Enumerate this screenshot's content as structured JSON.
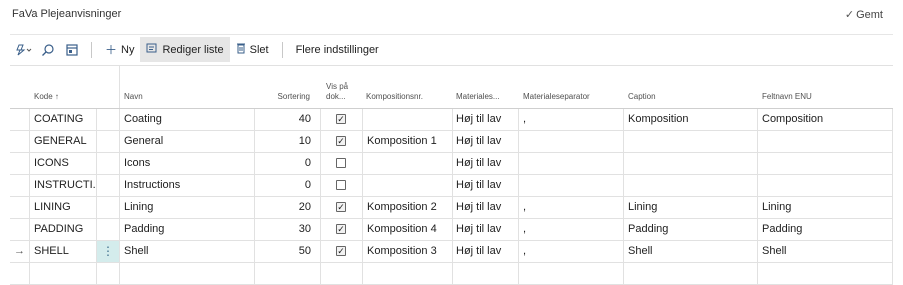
{
  "page": {
    "title": "FaVa Plejeanvisninger",
    "saved_status": "Gemt"
  },
  "toolbar": {
    "new_label": "Ny",
    "edit_list_label": "Rediger liste",
    "delete_label": "Slet",
    "more_settings_label": "Flere indstillinger"
  },
  "columns": {
    "kode": "Kode ↑",
    "navn": "Navn",
    "sortering": "Sortering",
    "vis_line1": "Vis på",
    "vis_line2": "dok...",
    "komposition": "Kompositionsnr.",
    "materiales": "Materiales...",
    "materialeseparator": "Materialeseparator",
    "caption": "Caption",
    "feltnavn": "Feltnavn ENU"
  },
  "rows": [
    {
      "kode": "COATING",
      "navn": "Coating",
      "sortering": "40",
      "vis": true,
      "komp": "",
      "mat": "Høj til lav",
      "sep": ",",
      "caption": "Komposition",
      "feltnavn": "Composition"
    },
    {
      "kode": "GENERAL",
      "navn": "General",
      "sortering": "10",
      "vis": true,
      "komp": "Komposition 1",
      "mat": "Høj til lav",
      "sep": "",
      "caption": "",
      "feltnavn": ""
    },
    {
      "kode": "ICONS",
      "navn": "Icons",
      "sortering": "0",
      "vis": false,
      "komp": "",
      "mat": "Høj til lav",
      "sep": "",
      "caption": "",
      "feltnavn": ""
    },
    {
      "kode": "INSTRUCTI...",
      "navn": "Instructions",
      "sortering": "0",
      "vis": false,
      "komp": "",
      "mat": "Høj til lav",
      "sep": "",
      "caption": "",
      "feltnavn": ""
    },
    {
      "kode": "LINING",
      "navn": "Lining",
      "sortering": "20",
      "vis": true,
      "komp": "Komposition 2",
      "mat": "Høj til lav",
      "sep": ",",
      "caption": "Lining",
      "feltnavn": "Lining"
    },
    {
      "kode": "PADDING",
      "navn": "Padding",
      "sortering": "30",
      "vis": true,
      "komp": "Komposition 4",
      "mat": "Høj til lav",
      "sep": ",",
      "caption": "Padding",
      "feltnavn": "Padding"
    },
    {
      "kode": "SHELL",
      "navn": "Shell",
      "sortering": "50",
      "vis": true,
      "komp": "Komposition 3",
      "mat": "Høj til lav",
      "sep": ",",
      "caption": "Shell",
      "feltnavn": "Shell"
    }
  ],
  "icons": {
    "checked": "☑",
    "check": "✓",
    "row_arrow": "→",
    "row_menu": "⋮"
  }
}
